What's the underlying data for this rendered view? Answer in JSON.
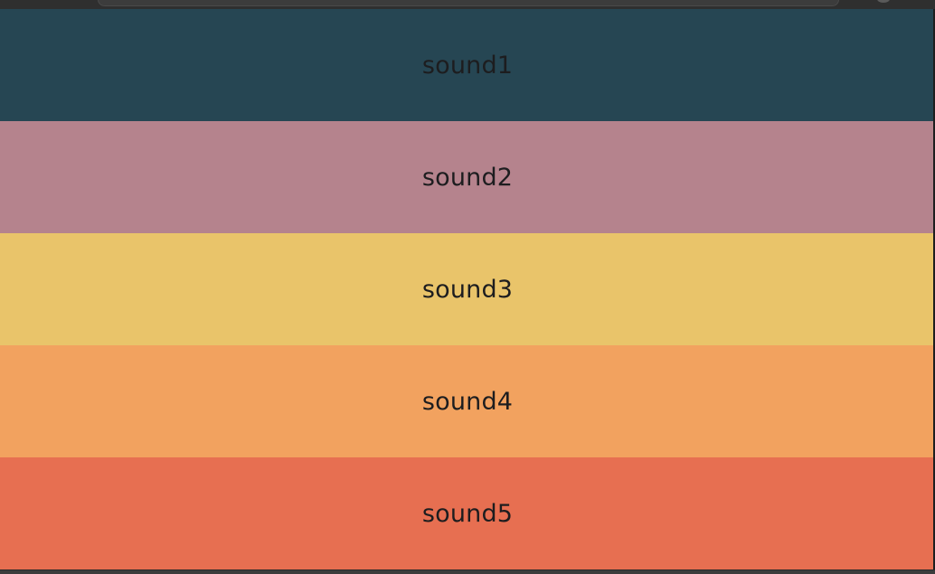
{
  "sound_buttons": [
    {
      "label": "sound1",
      "color": "#264653"
    },
    {
      "label": "sound2",
      "color": "#b5838d"
    },
    {
      "label": "sound3",
      "color": "#e9c46a"
    },
    {
      "label": "sound4",
      "color": "#f2a25f"
    },
    {
      "label": "sound5",
      "color": "#e76f51"
    }
  ]
}
